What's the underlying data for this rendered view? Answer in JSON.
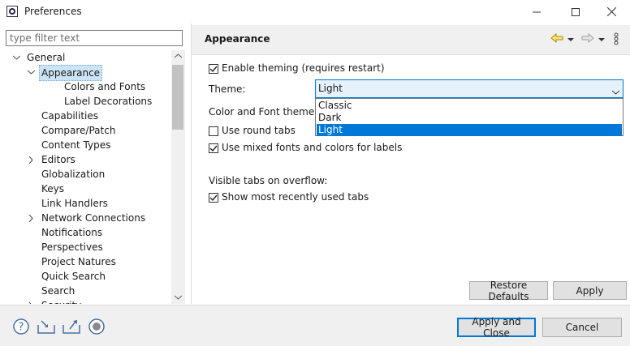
{
  "window": {
    "title": "Preferences"
  },
  "filter": {
    "placeholder": "type filter text"
  },
  "tree": {
    "items": [
      {
        "label": "General",
        "level": 0,
        "expander": "open"
      },
      {
        "label": "Appearance",
        "level": 1,
        "expander": "open",
        "selected": true
      },
      {
        "label": "Colors and Fonts",
        "level": 2,
        "expander": "none"
      },
      {
        "label": "Label Decorations",
        "level": 2,
        "expander": "none"
      },
      {
        "label": "Capabilities",
        "level": 1,
        "expander": "none"
      },
      {
        "label": "Compare/Patch",
        "level": 1,
        "expander": "none"
      },
      {
        "label": "Content Types",
        "level": 1,
        "expander": "none"
      },
      {
        "label": "Editors",
        "level": 1,
        "expander": "closed"
      },
      {
        "label": "Globalization",
        "level": 1,
        "expander": "none"
      },
      {
        "label": "Keys",
        "level": 1,
        "expander": "none"
      },
      {
        "label": "Link Handlers",
        "level": 1,
        "expander": "none"
      },
      {
        "label": "Network Connections",
        "level": 1,
        "expander": "closed"
      },
      {
        "label": "Notifications",
        "level": 1,
        "expander": "none"
      },
      {
        "label": "Perspectives",
        "level": 1,
        "expander": "none"
      },
      {
        "label": "Project Natures",
        "level": 1,
        "expander": "none"
      },
      {
        "label": "Quick Search",
        "level": 1,
        "expander": "none"
      },
      {
        "label": "Search",
        "level": 1,
        "expander": "none"
      },
      {
        "label": "Security",
        "level": 1,
        "expander": "closed"
      }
    ]
  },
  "page": {
    "title": "Appearance",
    "enable_theming": {
      "label": "Enable theming (requires restart)",
      "checked": true
    },
    "theme_label": "Theme:",
    "theme_value": "Light",
    "theme_options": [
      {
        "label": "Classic",
        "selected": false
      },
      {
        "label": "Dark",
        "selected": false
      },
      {
        "label": "Light",
        "selected": true
      }
    ],
    "color_font_theme_label": "Color and Font theme:",
    "round_tabs": {
      "label": "Use round tabs",
      "checked": false
    },
    "mixed_fonts": {
      "label": "Use mixed fonts and colors for labels",
      "checked": true
    },
    "visible_tabs_label": "Visible tabs on overflow:",
    "recent_tabs": {
      "label": "Show most recently used tabs",
      "checked": true
    },
    "restore_defaults": "Restore Defaults",
    "apply": "Apply"
  },
  "footer": {
    "apply_close": "Apply and Close",
    "cancel": "Cancel"
  },
  "colors": {
    "accent": "#0078d7",
    "selection": "#cce4f7",
    "panel": "#f0f0f0"
  }
}
